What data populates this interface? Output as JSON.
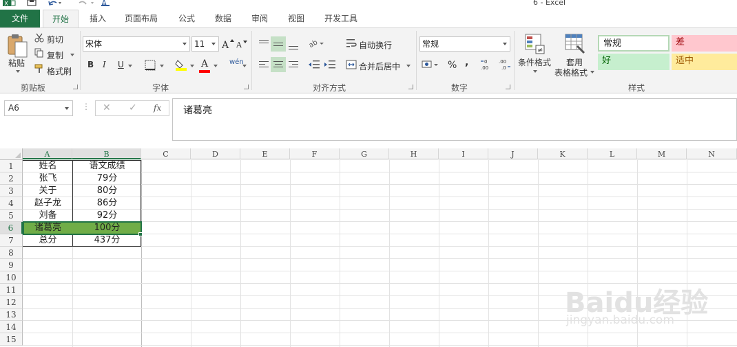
{
  "window": {
    "title": "6 - Excel"
  },
  "ribbon_tabs": [
    "文件",
    "开始",
    "插入",
    "页面布局",
    "公式",
    "数据",
    "审阅",
    "视图",
    "开发工具"
  ],
  "clipboard": {
    "paste": "粘贴",
    "cut": "剪切",
    "copy": "复制",
    "format_painter": "格式刷",
    "group": "剪贴板"
  },
  "font": {
    "name": "宋体",
    "size": "11",
    "group": "字体",
    "bold": "B",
    "italic": "I",
    "underline": "U",
    "font_color_glyph": "A",
    "phonetic": "wén"
  },
  "alignment": {
    "wrap_text": "自动换行",
    "merge_center": "合并后居中",
    "group": "对齐方式"
  },
  "number": {
    "format": "常规",
    "percent": "%",
    "comma": ",",
    "group": "数字"
  },
  "styles": {
    "conditional": "条件格式",
    "table_top": "套用",
    "table_bottom": "表格格式",
    "normal": "常规",
    "bad": "差",
    "good": "好",
    "neutral": "适中",
    "group": "样式"
  },
  "formula_bar": {
    "name_box": "A6",
    "fx": "fx",
    "value": "诸葛亮"
  },
  "columns": [
    "A",
    "B",
    "C",
    "D",
    "E",
    "F",
    "G",
    "H",
    "I",
    "J",
    "K",
    "L",
    "M",
    "N"
  ],
  "rows": [
    "1",
    "2",
    "3",
    "4",
    "5",
    "6",
    "7",
    "8",
    "9",
    "10",
    "11",
    "12",
    "13",
    "14",
    "15"
  ],
  "sheet": {
    "a": [
      "姓名",
      "张飞",
      "关于",
      "赵子龙",
      "刘备",
      "诸葛亮",
      "总分"
    ],
    "b": [
      "语文成绩",
      "79分",
      "80分",
      "86分",
      "92分",
      "100分",
      "437分"
    ]
  },
  "colors": {
    "excel_green": "#217346",
    "row_highlight": "#70ad47",
    "good_fill": "#c6efce",
    "bad_fill": "#ffc7ce",
    "neutral_fill": "#ffeb9c"
  },
  "watermark": {
    "brand": "Baidu经验",
    "url": "jingyan.baidu.com"
  }
}
